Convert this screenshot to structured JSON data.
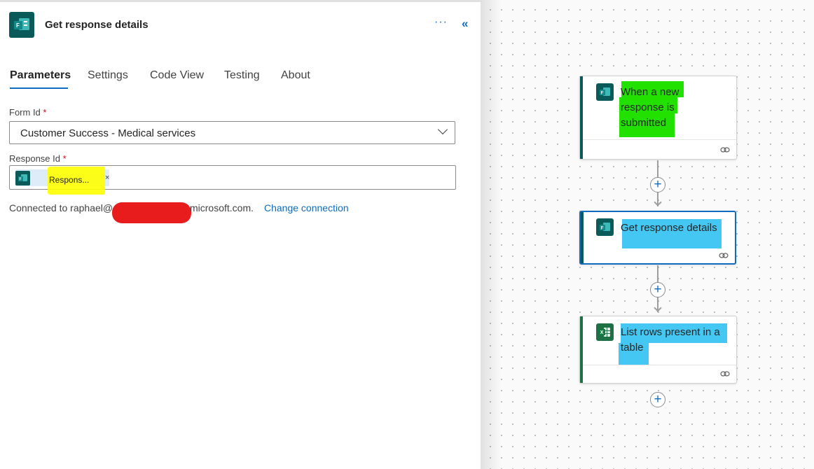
{
  "panel": {
    "title": "Get response details",
    "more_label": "···",
    "collapse_label": "«",
    "tabs": [
      {
        "label": "Parameters"
      },
      {
        "label": "Settings"
      },
      {
        "label": "Code View"
      },
      {
        "label": "Testing"
      },
      {
        "label": "About"
      }
    ],
    "active_tab": "Parameters",
    "form_id": {
      "label": "Form Id",
      "required_mark": "*",
      "value": "Customer Success - Medical services"
    },
    "response_id": {
      "label": "Response Id",
      "required_mark": "*",
      "token_label": "Respons...",
      "token_close": "×"
    },
    "connection": {
      "prefix": "Connected to raphael@",
      "suffix": "microsoft.com.",
      "change_link": "Change connection"
    }
  },
  "canvas": {
    "cards": [
      {
        "title_line1": "When a new",
        "title_line2": "response is",
        "title_line3": "submitted",
        "icon": "forms-icon",
        "highlight": "#22e000"
      },
      {
        "title": "Get response details",
        "icon": "forms-icon",
        "highlight": "#45c7f3",
        "selected": true
      },
      {
        "title_line1": "List rows present in a",
        "title_line2": "table",
        "icon": "excel-icon",
        "highlight": "#45c7f3"
      }
    ],
    "add_step_label": "+"
  },
  "colors": {
    "forms_accent": "#0b5a5a",
    "excel_accent": "#1e7145",
    "link_blue": "#0f6cbd",
    "redaction": "#e81c1c",
    "token_highlight": "#ffff00"
  }
}
